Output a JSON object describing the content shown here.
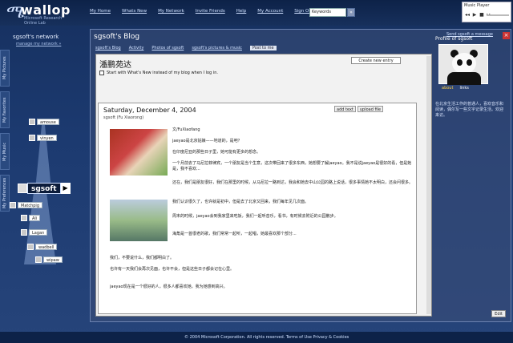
{
  "header": {
    "logo_mark": "ሜ",
    "logo_word": "wallop",
    "logo_sub": "Microsoft Research Online Lab",
    "nav": [
      "My Home",
      "Whats New",
      "My Network",
      "Invite Friends",
      "Help",
      "My Account",
      "Sign Out"
    ],
    "search_value": "Keywords",
    "search_go": "»"
  },
  "music": {
    "title": "Music Player",
    "controls": [
      "◂◂",
      "▶",
      "■",
      "▸▸"
    ]
  },
  "network": {
    "title": "sgsoft's network",
    "manage_link": "manage my network »",
    "tabs": [
      "My Pictures",
      "My Favorites",
      "My Music",
      "My Preferences"
    ],
    "me_label": "sgsoft",
    "nodes": [
      "amouse",
      "vinyen",
      "Matchpig",
      "Ali",
      "Lagan",
      "wadbell",
      "wipaw"
    ]
  },
  "window": {
    "title": "sgsoft's Blog",
    "links": [
      "sgsoft's Blog",
      "Activity",
      "Photos of sgsoft",
      "sgsoft's pictures & music",
      "Post to me"
    ],
    "send_message": "Send sgsoft a message",
    "close": "×"
  },
  "blog": {
    "name": "潘鹏苑达",
    "create_button": "Create new entry",
    "checkbox_label": "Start with What's New instead of my blog when I log in.",
    "post": {
      "date": "Saturday, December 4, 2004",
      "meta": "sgsoft (Fu Xiaorong)",
      "buttons": [
        "add text",
        "upload file"
      ],
      "paragraphs": [
        "文/FuXiaofang",
        "jaeyao是北京姑娘——地道的，是吧？",
        "在印度尼亚的那些日子里，她可能有更多的想念。",
        "一个月前去了马尼拉菲律宾，一个朋友是当个生意，这次带回来了很多东西，她想要了解jaeyao。我不是说jaeyao是很好的看，但是她是，我不喜欢...",
        "还在，我们是朋友很好，我们在那里的时候，从马尼拉一路到达，我会和她去中山公园的路上说话，很多事情她不太明白，还会问很多。",
        "我们认识很久了，也许就是初中，但是去了北京又回来，我们每年见几次面。",
        "周末的时候，jaeyao会到我家里来吃饭，我们一起听音乐，看书，有时候去附近的公园散步。",
        "海角是一首很老的歌，我们常常一起听，一起唱，她最喜欢那个部分...",
        "我们，不要说什么，我们都明白了。",
        "也许有一天我们会再次见面，也许不会，但是这些日子都会记在心里。",
        "jaeyao现在是一个很好的人，很多人都喜欢她，我为她感到高兴。"
      ]
    }
  },
  "profile": {
    "title": "Profile of sgsoft",
    "tabs": [
      "about",
      "links"
    ],
    "text": "在北京生活工作的普通人，喜欢音乐和阅读，偶尔写一些文字记录生活。欢迎来访。",
    "ok": "Edit"
  },
  "footer": {
    "text": "© 2004 Microsoft Corporation. All rights reserved. Terms of Use  Privacy & Cookies"
  }
}
